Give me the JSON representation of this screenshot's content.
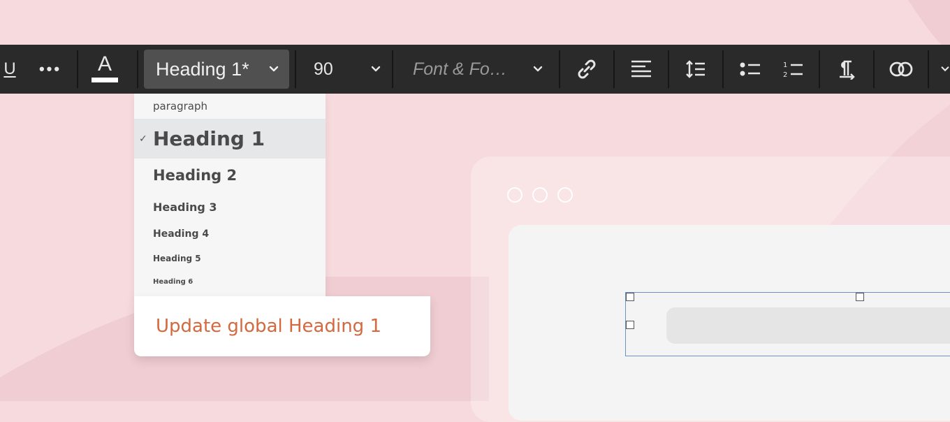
{
  "toolbar": {
    "underline_glyph": "U",
    "more_glyph": "•••",
    "text_color_glyph": "A",
    "heading_select_value": "Heading 1*",
    "font_size_value": "90",
    "font_family_value": "Font & Fo…"
  },
  "dropdown": {
    "items": [
      {
        "label": "paragraph"
      },
      {
        "label": "Heading 1",
        "selected": true
      },
      {
        "label": "Heading 2"
      },
      {
        "label": "Heading 3"
      },
      {
        "label": "Heading 4"
      },
      {
        "label": "Heading 5"
      },
      {
        "label": "Heading 6"
      }
    ],
    "check_glyph": "✓",
    "update_label": "Update global Heading 1"
  },
  "icons": [
    "underline-icon",
    "more-icon",
    "text-color-icon",
    "chevron-down-icon",
    "link-icon",
    "align-left-icon",
    "line-height-icon",
    "bullet-list-icon",
    "numbered-list-icon",
    "paragraph-icon",
    "link-circles-icon"
  ],
  "colors": {
    "toolbar_bg": "#2a2a2a",
    "accent_orange": "#d4683e",
    "page_bg": "#f7dadd",
    "selection_blue": "#6a93c4"
  }
}
